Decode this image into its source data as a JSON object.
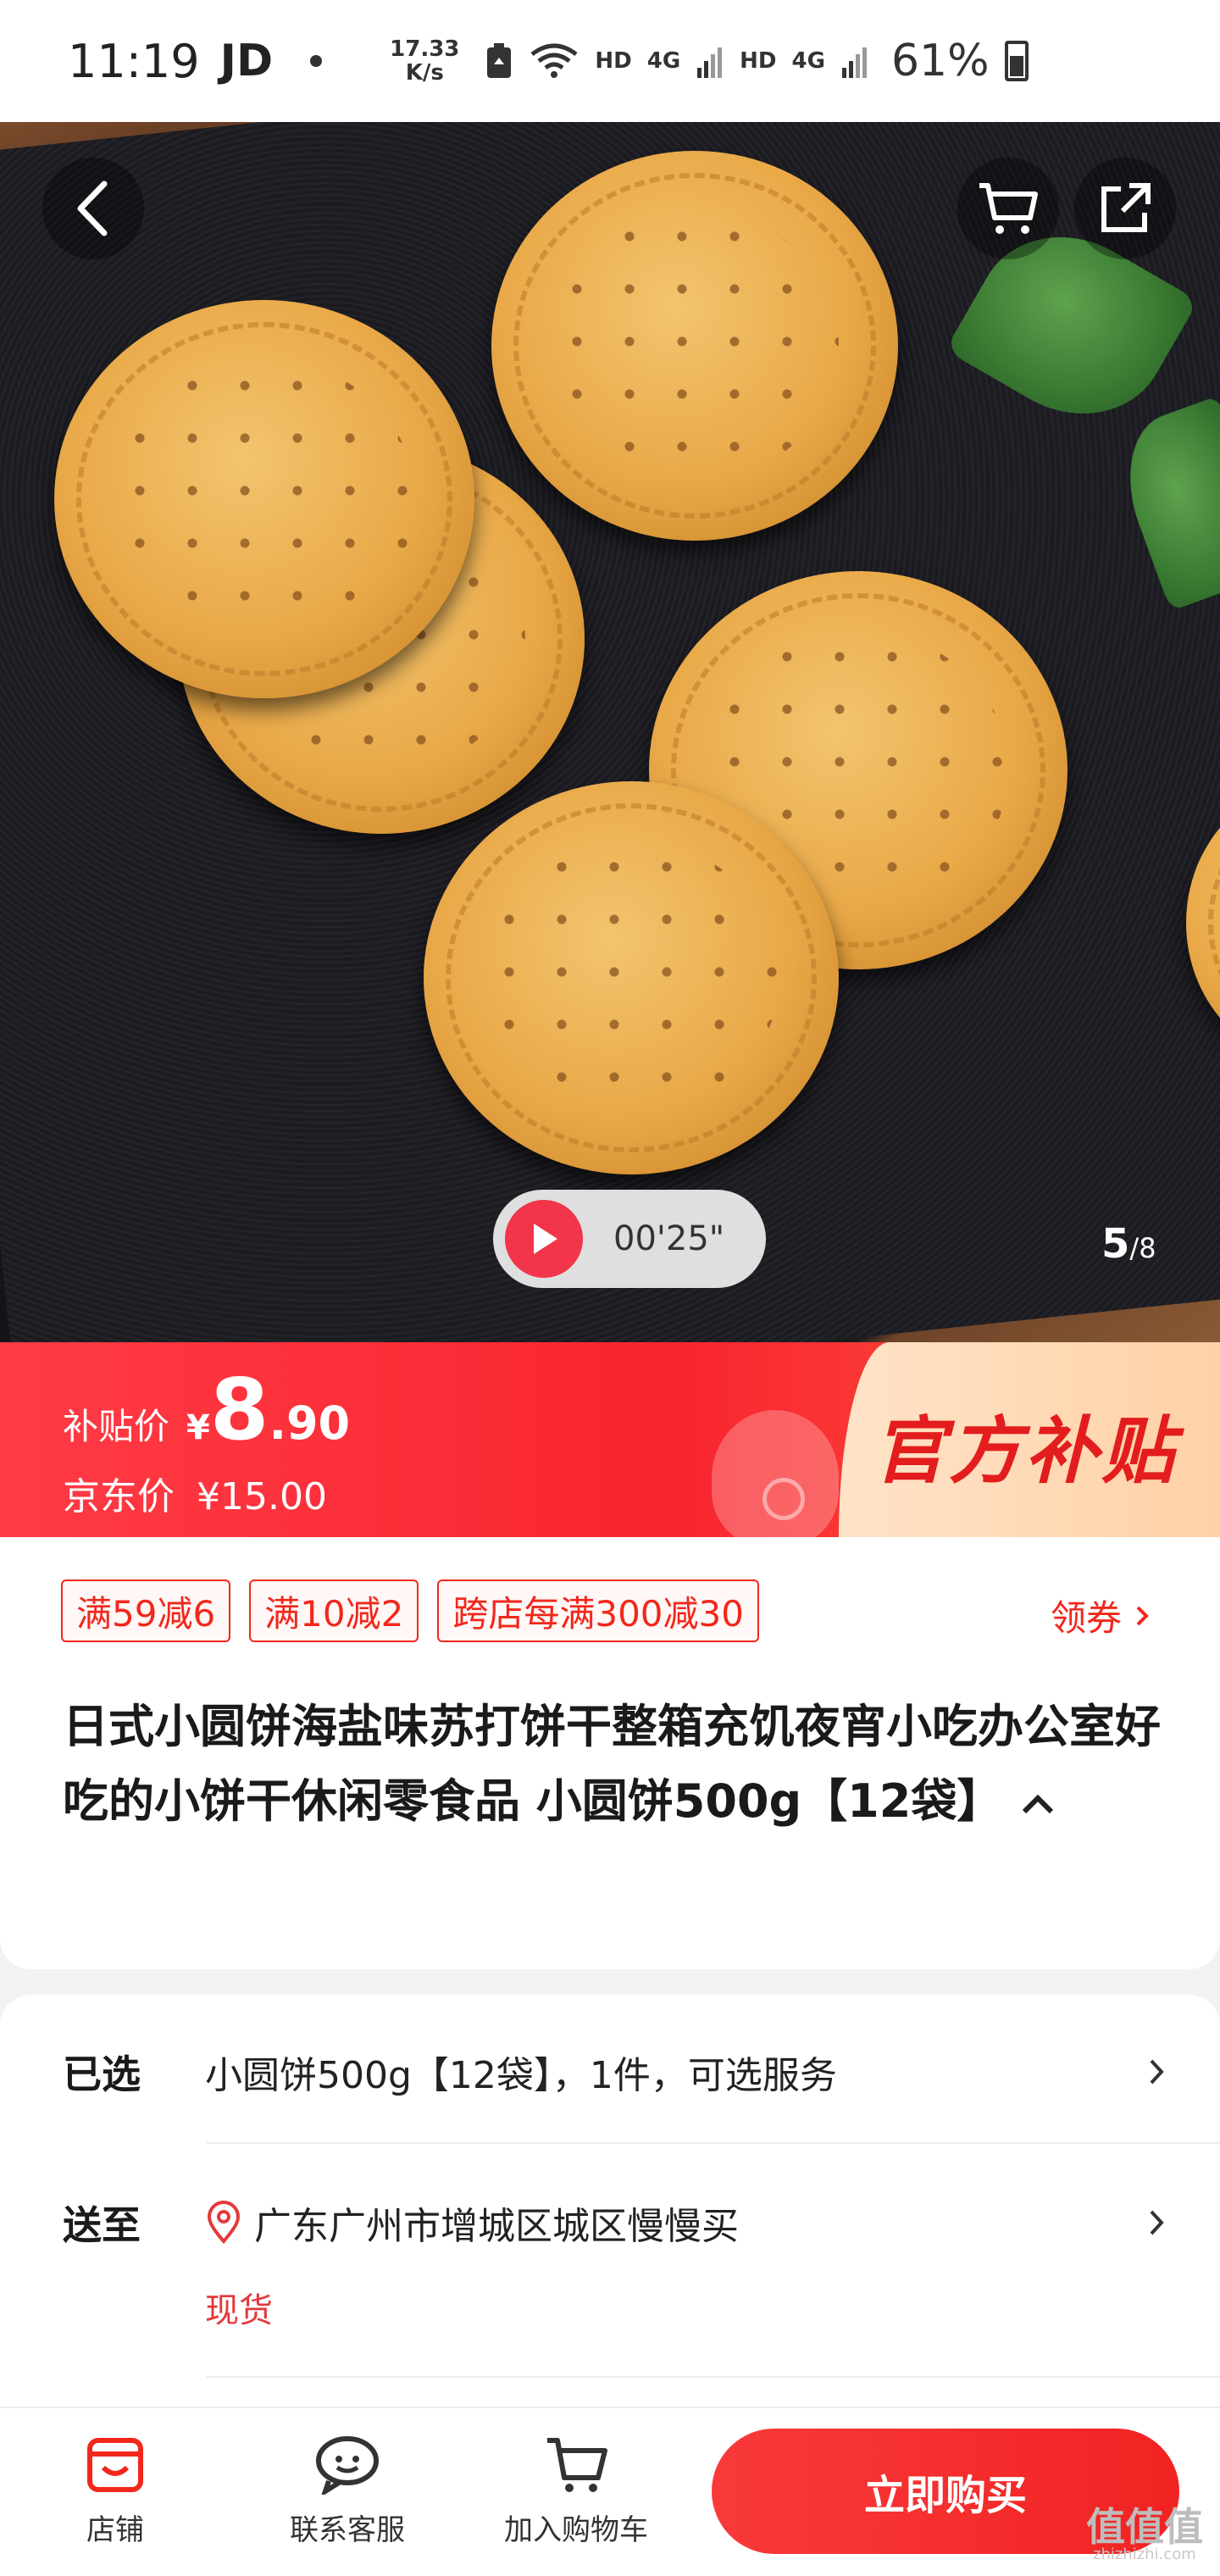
{
  "status_bar": {
    "time": "11:19",
    "carrier": "JD",
    "net_speed_value": "17.33",
    "net_speed_unit": "K/s",
    "hd1": "HD",
    "net1": "4G",
    "hd2": "HD",
    "net2": "4G",
    "battery": "61%"
  },
  "gallery": {
    "video_duration": "00'25\"",
    "current": "5",
    "total": "/8"
  },
  "price": {
    "subsidy_label": "补贴价",
    "currency": "¥",
    "subsidy_int": "8",
    "subsidy_dec": ".90",
    "jd_label": "京东价",
    "jd_price": "¥15.00",
    "official_tag": "官方补贴"
  },
  "coupons": [
    "满59减6",
    "满10减2",
    "跨店每满300减30"
  ],
  "coupon_get_label": "领券",
  "product_title": "日式小圆饼海盐味苏打饼干整箱充饥夜宵小吃办公室好吃的小饼干休闲零食品 小圆饼500g【12袋】",
  "selected": {
    "key": "已选",
    "value": "小圆饼500g【12袋】，1件，可选服务"
  },
  "delivery": {
    "key": "送至",
    "address": "广东广州市增城区城区慢慢买",
    "stock": "现货"
  },
  "bottom_bar": {
    "shop": "店铺",
    "service": "联系客服",
    "add_cart": "加入购物车",
    "buy_now": "立即购买"
  },
  "watermark": {
    "main": "值值值",
    "sub": "zhizhizhi.com"
  },
  "colors": {
    "jd_red": "#f2271c",
    "banner_red": "#f8242f",
    "banner_cream": "#ffd1a6"
  }
}
